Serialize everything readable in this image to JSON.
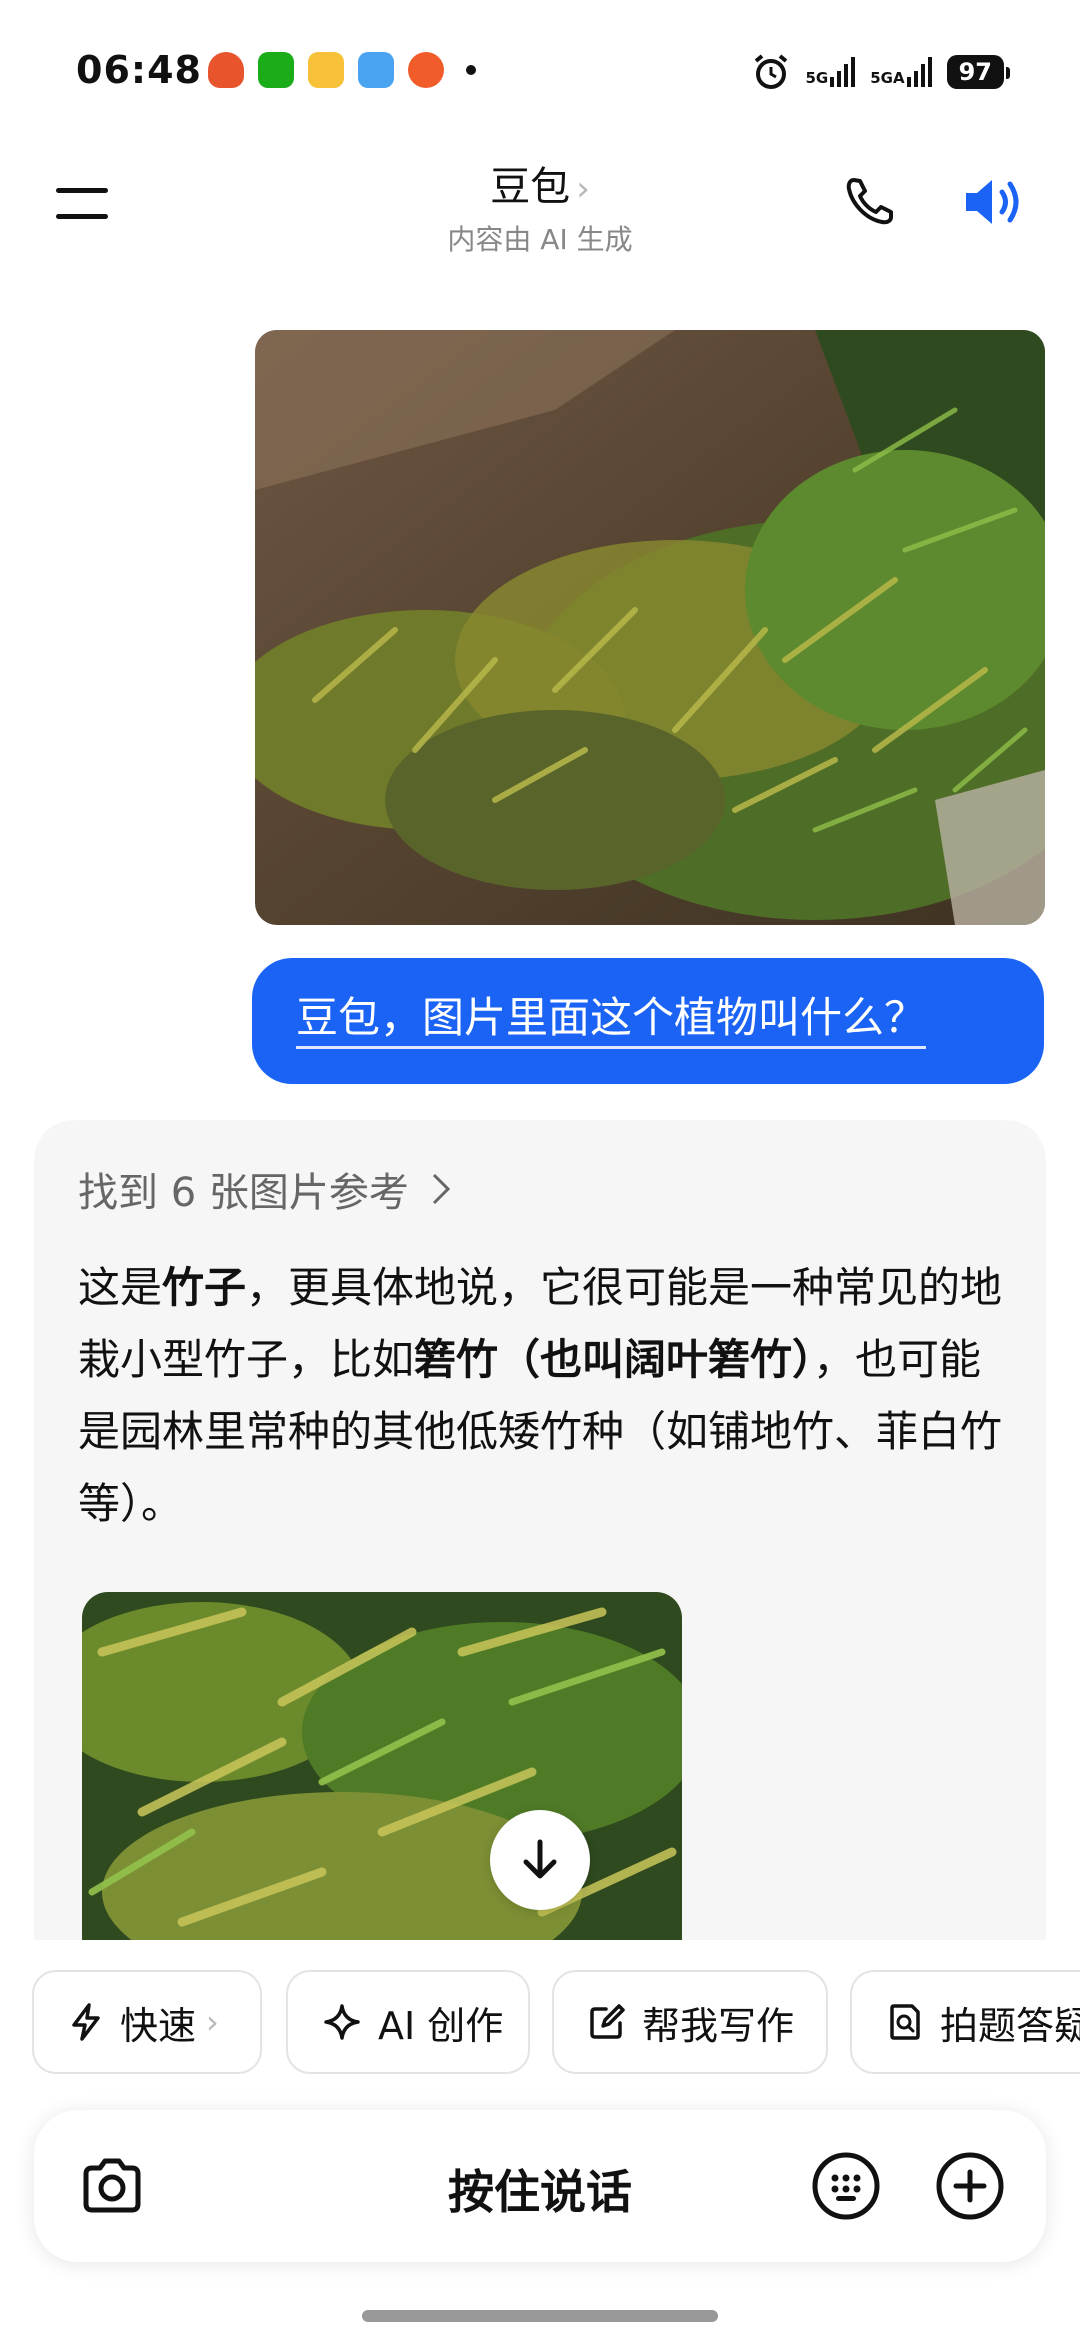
{
  "status_bar": {
    "time": "06:48",
    "battery": "97",
    "network_1": "5G",
    "network_2": "5GA",
    "app_icons": [
      "shopping-icon",
      "wechat-pay-icon",
      "food-icon",
      "weather-icon",
      "game-icon"
    ]
  },
  "header": {
    "title": "豆包",
    "chevron": "›",
    "subtitle": "内容由 AI 生成"
  },
  "chat": {
    "user_message": "豆包，图片里面这个植物叫什么？",
    "ai_reply": {
      "reference_link": "找到 6 张图片参考",
      "p1_a": "这是",
      "p1_b": "竹子",
      "p1_c": "，更具体地说，它很可能是一种常见的地栽小型竹子，比如",
      "p1_d": "箬竹（也叫阔叶箬竹）",
      "p1_e": "，也可能是园林里常种的其他低矮竹种（如铺地竹、菲白竹等）。"
    }
  },
  "chips": [
    {
      "label": "快速",
      "icon": "lightning-icon",
      "chevron": "›"
    },
    {
      "label": "AI 创作",
      "icon": "sparkle-icon"
    },
    {
      "label": "帮我写作",
      "icon": "edit-icon"
    },
    {
      "label": "拍题答疑",
      "icon": "question-scan-icon"
    }
  ],
  "input_bar": {
    "hold_to_talk": "按住说话"
  },
  "colors": {
    "accent": "#1b63f5",
    "card_bg": "#f6f6f6"
  }
}
